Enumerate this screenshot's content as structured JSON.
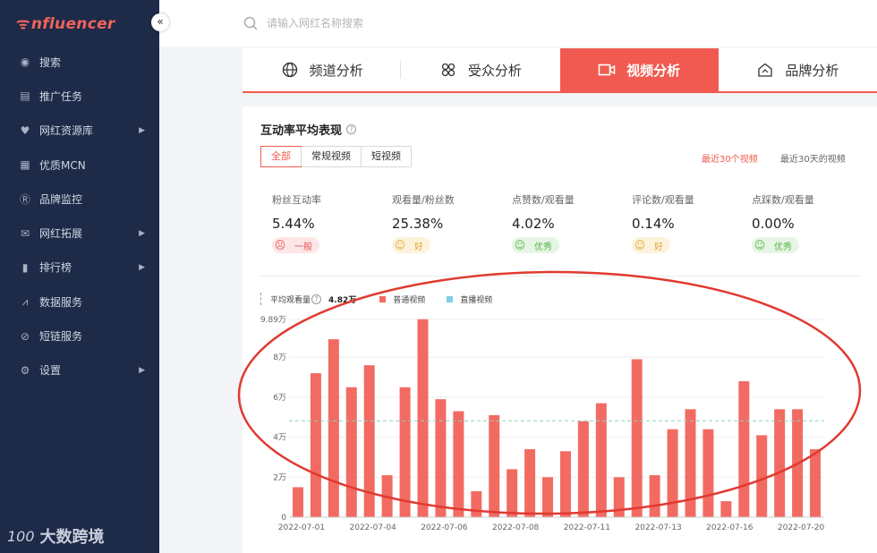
{
  "sidebar": {
    "logo": "nfluencer",
    "collapse_label": "«",
    "items": [
      {
        "label": "搜索",
        "icon": "compass-icon",
        "arrow": false
      },
      {
        "label": "推广任务",
        "icon": "document-icon",
        "arrow": false
      },
      {
        "label": "网红资源库",
        "icon": "heart-icon",
        "arrow": true
      },
      {
        "label": "优质MCN",
        "icon": "mcn-icon",
        "arrow": false
      },
      {
        "label": "品牌监控",
        "icon": "r-badge-icon",
        "arrow": false
      },
      {
        "label": "网红拓展",
        "icon": "mail-icon",
        "arrow": true
      },
      {
        "label": "排行榜",
        "icon": "bar-chart-icon",
        "arrow": true
      },
      {
        "label": "数据服务",
        "icon": "trend-icon",
        "arrow": false
      },
      {
        "label": "短链服务",
        "icon": "link-icon",
        "arrow": false
      },
      {
        "label": "设置",
        "icon": "gear-icon",
        "arrow": true
      }
    ],
    "footer_mark": "100",
    "footer_text": "大数跨境"
  },
  "search": {
    "placeholder": "请输入网红名称搜索"
  },
  "tabs": [
    {
      "label": "频道分析",
      "icon": "globe-icon",
      "active": false
    },
    {
      "label": "受众分析",
      "icon": "audience-icon",
      "active": false
    },
    {
      "label": "视频分析",
      "icon": "video-icon",
      "active": true
    },
    {
      "label": "品牌分析",
      "icon": "brand-icon",
      "active": false
    }
  ],
  "panel": {
    "title": "互动率平均表现",
    "segments": [
      "全部",
      "常规视频",
      "短视频"
    ],
    "range_recent30": "最近30个视频",
    "range_30days": "最近30天的视频"
  },
  "metrics": [
    {
      "label": "粉丝互动率",
      "value": "5.44%",
      "badge": "一般",
      "level": "normal"
    },
    {
      "label": "观看量/粉丝数",
      "value": "25.38%",
      "badge": "好",
      "level": "good"
    },
    {
      "label": "点赞数/观看量",
      "value": "4.02%",
      "badge": "优秀",
      "level": "great"
    },
    {
      "label": "评论数/观看量",
      "value": "0.14%",
      "badge": "好",
      "level": "good"
    },
    {
      "label": "点踩数/观看量",
      "value": "0.00%",
      "badge": "优秀",
      "level": "great"
    }
  ],
  "legend": {
    "avg_label": "平均观看量",
    "avg_value": "4.82万",
    "series_normal": "普通视频",
    "series_live": "直播视频"
  },
  "colors": {
    "accent": "#f05a50",
    "bar": "#f26b63",
    "live": "#7ecfe8",
    "avg_line": "#8fd0c0"
  },
  "chart_data": {
    "type": "bar",
    "ylim": [
      0,
      9.89
    ],
    "y_ticks": [
      "0",
      "2万",
      "4万",
      "6万",
      "8万",
      "9.89万"
    ],
    "y_tick_values": [
      0,
      2,
      4,
      6,
      8,
      9.89
    ],
    "average": 4.82,
    "x_tick_labels": [
      "2022-07-01",
      "2022-07-04",
      "2022-07-06",
      "2022-07-08",
      "2022-07-11",
      "2022-07-13",
      "2022-07-16",
      "2022-07-20"
    ],
    "x_tick_positions": [
      1,
      5,
      9,
      13,
      17,
      21,
      25,
      29
    ],
    "series": [
      {
        "name": "普通视频",
        "values": [
          1.5,
          7.2,
          8.9,
          6.5,
          7.6,
          2.1,
          6.5,
          9.9,
          5.9,
          5.3,
          1.3,
          5.1,
          2.4,
          3.4,
          2.0,
          3.3,
          4.8,
          5.7,
          2.0,
          7.9,
          2.1,
          4.4,
          5.4,
          4.4,
          0.8,
          6.8,
          4.1,
          5.4,
          5.4,
          3.4
        ]
      }
    ]
  }
}
